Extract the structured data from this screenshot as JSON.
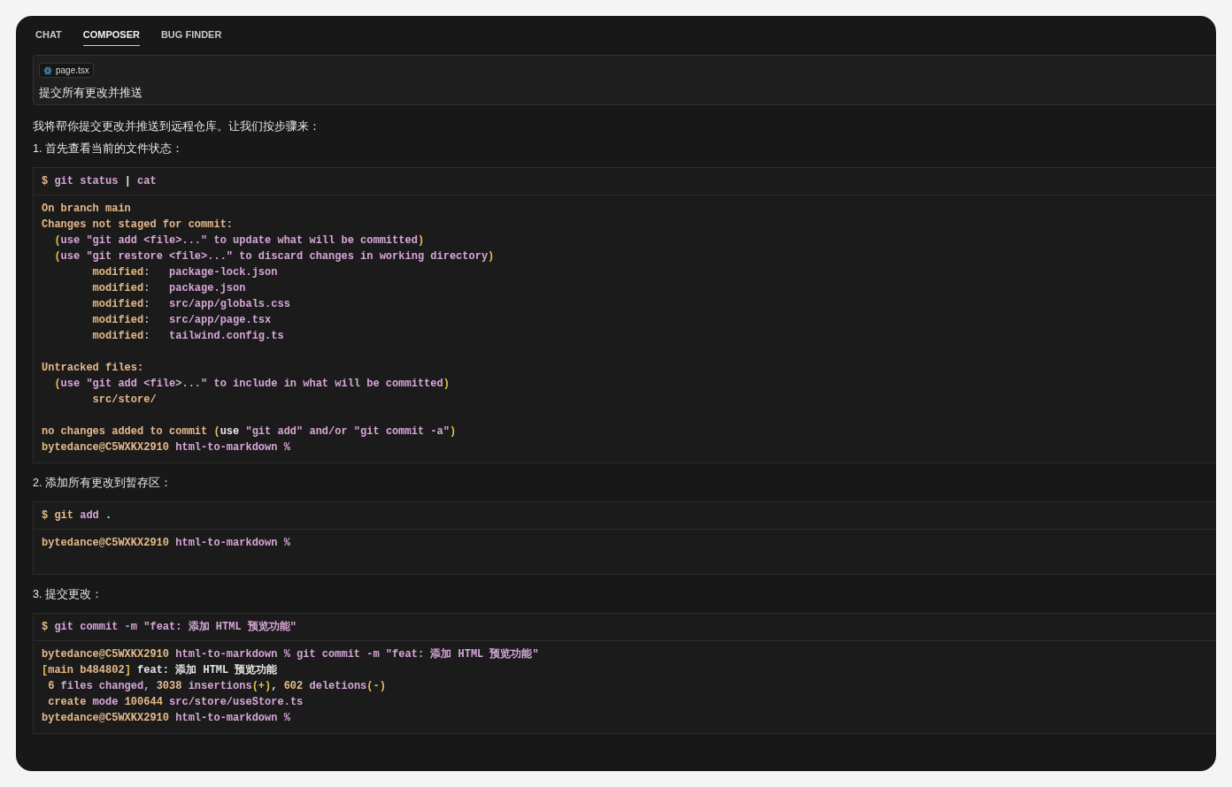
{
  "tabs": [
    {
      "label": "CHAT",
      "selected": false
    },
    {
      "label": "COMPOSER",
      "selected": true
    },
    {
      "label": "BUG FINDER",
      "selected": false
    }
  ],
  "prompt": {
    "file_chip": "page.tsx",
    "text": "提交所有更改并推送"
  },
  "messages": [
    {
      "kind": "text",
      "text": "我将帮你提交更改并推送到远程仓库。让我们按步骤来："
    },
    {
      "kind": "text",
      "text": "1. 首先查看当前的文件状态："
    },
    {
      "kind": "terminal",
      "command": [
        {
          "text": "$ ",
          "color": "#e6b98a"
        },
        {
          "text": "git status ",
          "color": "#d7a6d8"
        },
        {
          "text": "| ",
          "color": "#e6e6e6"
        },
        {
          "text": "cat",
          "color": "#d7a6d8"
        }
      ],
      "output": [
        {
          "kind": "text",
          "segments": [
            {
              "text": "On branch main",
              "color": "#e6b98a"
            }
          ]
        },
        {
          "kind": "text",
          "segments": [
            {
              "text": "Changes not staged for commit:",
              "color": "#e6b98a"
            }
          ]
        },
        {
          "kind": "text",
          "segments": [
            {
              "text": "  (",
              "color": "#e5c04f"
            },
            {
              "text": "use \"git add <file>...\" to update what will be committed",
              "color": "#d7a6d8"
            },
            {
              "text": ")",
              "color": "#e5c04f"
            }
          ]
        },
        {
          "kind": "text",
          "segments": [
            {
              "text": "  (",
              "color": "#e5c04f"
            },
            {
              "text": "use \"git restore <file>...\" to discard changes in working directory",
              "color": "#d7a6d8"
            },
            {
              "text": ")",
              "color": "#e5c04f"
            }
          ]
        },
        {
          "kind": "text",
          "segments": [
            {
              "text": "        modified:   ",
              "color": "#e6b98a"
            },
            {
              "text": "package-lock.json",
              "color": "#d7a6d8"
            }
          ]
        },
        {
          "kind": "text",
          "segments": [
            {
              "text": "        modified:   ",
              "color": "#e6b98a"
            },
            {
              "text": "package.json",
              "color": "#d7a6d8"
            }
          ]
        },
        {
          "kind": "text",
          "segments": [
            {
              "text": "        modified:   ",
              "color": "#e6b98a"
            },
            {
              "text": "src/app/globals.css",
              "color": "#d7a6d8"
            }
          ]
        },
        {
          "kind": "text",
          "segments": [
            {
              "text": "        modified:   ",
              "color": "#e6b98a"
            },
            {
              "text": "src/app/page.tsx",
              "color": "#d7a6d8"
            }
          ]
        },
        {
          "kind": "text",
          "segments": [
            {
              "text": "        modified:   ",
              "color": "#e6b98a"
            },
            {
              "text": "tailwind.config.ts",
              "color": "#d7a6d8"
            }
          ]
        },
        {
          "kind": "blank"
        },
        {
          "kind": "text",
          "segments": [
            {
              "text": "Untracked files:",
              "color": "#e6b98a"
            }
          ]
        },
        {
          "kind": "text",
          "segments": [
            {
              "text": "  (",
              "color": "#e5c04f"
            },
            {
              "text": "use \"git add <file>...\" to include in what will be committed",
              "color": "#d7a6d8"
            },
            {
              "text": ")",
              "color": "#e5c04f"
            }
          ]
        },
        {
          "kind": "text",
          "segments": [
            {
              "text": "        src/store/",
              "color": "#e6b98a"
            }
          ]
        },
        {
          "kind": "blank"
        },
        {
          "kind": "text",
          "segments": [
            {
              "text": "no changes added to commit ",
              "color": "#e6b98a"
            },
            {
              "text": "(",
              "color": "#e5c04f"
            },
            {
              "text": "use",
              "color": "#e6e6e6"
            },
            {
              "text": " \"git add\" and/or \"git commit -a\"",
              "color": "#d7a6d8"
            },
            {
              "text": ")",
              "color": "#e5c04f"
            }
          ]
        },
        {
          "kind": "text",
          "segments": [
            {
              "text": "bytedance@C5WXKX2910",
              "color": "#e6b98a"
            },
            {
              "text": " html-to-markdown %",
              "color": "#d7a6d8"
            }
          ]
        }
      ]
    },
    {
      "kind": "text",
      "text": "2. 添加所有更改到暂存区："
    },
    {
      "kind": "terminal",
      "command": [
        {
          "text": "$ ",
          "color": "#e6b98a"
        },
        {
          "text": "git ",
          "color": "#e6b98a"
        },
        {
          "text": "add ",
          "color": "#d7a6d8"
        },
        {
          "text": "."
        }
      ],
      "output": [
        {
          "kind": "text",
          "segments": [
            {
              "text": "bytedance@C5WXKX2910",
              "color": "#e6b98a"
            },
            {
              "text": " html-to-markdown %",
              "color": "#d7a6d8"
            }
          ]
        },
        {
          "kind": "blank"
        }
      ]
    },
    {
      "kind": "text",
      "text": "3. 提交更改："
    },
    {
      "kind": "terminal",
      "command": [
        {
          "text": "$ ",
          "color": "#e6b98a"
        },
        {
          "text": "git commit -m \"feat: 添加 HTML 预览功能\"",
          "color": "#d7a6d8"
        }
      ],
      "output": [
        {
          "kind": "text",
          "segments": [
            {
              "text": "bytedance@C5WXKX2910",
              "color": "#e6b98a"
            },
            {
              "text": " html-to-markdown % git commit -m \"feat: 添加 HTML 预览功能\"",
              "color": "#d7a6d8"
            }
          ]
        },
        {
          "kind": "text",
          "segments": [
            {
              "text": "[",
              "color": "#e5c04f"
            },
            {
              "text": "main b484802",
              "color": "#e6b98a"
            },
            {
              "text": "]",
              "color": "#e5c04f"
            },
            {
              "text": " feat: 添加 HTML 预览功能",
              "color": "#e6e6e6"
            }
          ]
        },
        {
          "kind": "text",
          "segments": [
            {
              "text": " 6",
              "color": "#e6b98a"
            },
            {
              "text": " files changed, ",
              "color": "#d7a6d8"
            },
            {
              "text": "3038",
              "color": "#e6b98a"
            },
            {
              "text": " insertions",
              "color": "#d7a6d8"
            },
            {
              "text": "(+)",
              "color": "#e5c04f"
            },
            {
              "text": ", "
            },
            {
              "text": "602",
              "color": "#e6b98a"
            },
            {
              "text": " deletions",
              "color": "#d7a6d8"
            },
            {
              "text": "(-)",
              "color": "#e5c04f"
            }
          ]
        },
        {
          "kind": "text",
          "segments": [
            {
              "text": " create",
              "color": "#e6b98a"
            },
            {
              "text": " mode ",
              "color": "#d7a6d8"
            },
            {
              "text": "100644",
              "color": "#e6b98a"
            },
            {
              "text": " src/store/useStore.ts",
              "color": "#d7a6d8"
            }
          ]
        },
        {
          "kind": "text",
          "segments": [
            {
              "text": "bytedance@C5WXKX2910",
              "color": "#e6b98a"
            },
            {
              "text": " html-to-markdown %",
              "color": "#d7a6d8"
            }
          ]
        }
      ]
    }
  ]
}
